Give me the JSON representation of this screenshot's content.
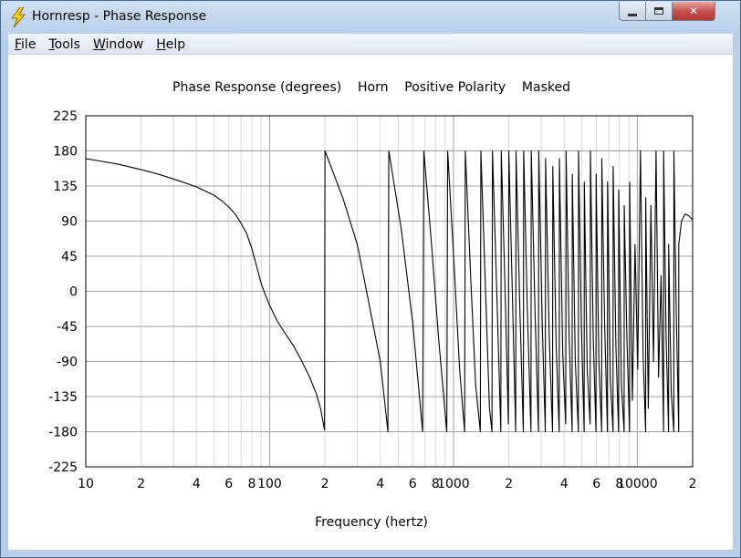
{
  "window": {
    "title": "Hornresp - Phase Response",
    "close_glyph": "✕"
  },
  "menu": {
    "items": [
      {
        "label": "File",
        "accel": "F",
        "rest": "ile"
      },
      {
        "label": "Tools",
        "accel": "T",
        "rest": "ools"
      },
      {
        "label": "Window",
        "accel": "W",
        "rest": "indow"
      },
      {
        "label": "Help",
        "accel": "H",
        "rest": "elp"
      }
    ]
  },
  "icons": {
    "app": "lightning-bolt-icon",
    "minimize": "minimize-icon",
    "maximize": "maximize-icon",
    "close": "close-icon"
  },
  "colors": {
    "trace": "#000000",
    "major_grid": "#a0a0a0",
    "minor_grid": "#d8d8d8",
    "close_button": "#c75050",
    "app_icon": "#f5d020"
  },
  "chart_data": {
    "type": "line",
    "title": "Phase Response (degrees)    Horn    Positive Polarity    Masked",
    "xlabel": "Frequency (hertz)",
    "ylabel": "",
    "xscale": "log",
    "xlim": [
      10,
      20000
    ],
    "ylim": [
      -225,
      225
    ],
    "yticks": [
      225,
      180,
      135,
      90,
      45,
      0,
      -45,
      -90,
      -135,
      -180,
      -225
    ],
    "xtick_labels": [
      {
        "value": 10,
        "label": "10"
      },
      {
        "value": 20,
        "label": "2"
      },
      {
        "value": 40,
        "label": "4"
      },
      {
        "value": 60,
        "label": "6"
      },
      {
        "value": 80,
        "label": "8"
      },
      {
        "value": 100,
        "label": "100"
      },
      {
        "value": 200,
        "label": "2"
      },
      {
        "value": 400,
        "label": "4"
      },
      {
        "value": 600,
        "label": "6"
      },
      {
        "value": 800,
        "label": "8"
      },
      {
        "value": 1000,
        "label": "1000"
      },
      {
        "value": 2000,
        "label": "2"
      },
      {
        "value": 4000,
        "label": "4"
      },
      {
        "value": 6000,
        "label": "6"
      },
      {
        "value": 8000,
        "label": "8"
      },
      {
        "value": 10000,
        "label": "10000"
      },
      {
        "value": 20000,
        "label": "2"
      }
    ],
    "grid": true,
    "series": [
      {
        "name": "",
        "wrap_range": [
          -180,
          180
        ],
        "points": [
          [
            10,
            170
          ],
          [
            12,
            167
          ],
          [
            15,
            163
          ],
          [
            20,
            156
          ],
          [
            25,
            150
          ],
          [
            30,
            144
          ],
          [
            40,
            134
          ],
          [
            50,
            123
          ],
          [
            55,
            116
          ],
          [
            60,
            108
          ],
          [
            65,
            99
          ],
          [
            70,
            87
          ],
          [
            75,
            74
          ],
          [
            80,
            55
          ],
          [
            85,
            32
          ],
          [
            90,
            10
          ],
          [
            95,
            -5
          ],
          [
            100,
            -18
          ],
          [
            110,
            -38
          ],
          [
            120,
            -52
          ],
          [
            135,
            -70
          ],
          [
            150,
            -90
          ],
          [
            165,
            -110
          ],
          [
            180,
            -132
          ],
          [
            190,
            -152
          ],
          [
            199,
            -178
          ],
          [
            200,
            180
          ],
          [
            250,
            120
          ],
          [
            300,
            60
          ],
          [
            350,
            -20
          ],
          [
            400,
            -90
          ],
          [
            440,
            -180
          ],
          [
            445,
            180
          ],
          [
            520,
            80
          ],
          [
            600,
            -40
          ],
          [
            680,
            -180
          ],
          [
            690,
            180
          ],
          [
            760,
            60
          ],
          [
            830,
            -60
          ],
          [
            920,
            -180
          ],
          [
            930,
            180
          ],
          [
            1010,
            30
          ],
          [
            1080,
            -100
          ],
          [
            1150,
            -180
          ],
          [
            1160,
            180
          ],
          [
            1240,
            20
          ],
          [
            1320,
            -120
          ],
          [
            1400,
            -180
          ],
          [
            1410,
            180
          ],
          [
            1490,
            10
          ],
          [
            1570,
            -150
          ],
          [
            1620,
            -180
          ],
          [
            1630,
            180
          ],
          [
            1720,
            0
          ],
          [
            1810,
            -180
          ],
          [
            1820,
            180
          ],
          [
            1900,
            20
          ],
          [
            1990,
            -170
          ],
          [
            2000,
            180
          ],
          [
            2090,
            0
          ],
          [
            2180,
            -180
          ],
          [
            2190,
            180
          ],
          [
            2290,
            -10
          ],
          [
            2400,
            -180
          ],
          [
            2410,
            180
          ],
          [
            2520,
            -20
          ],
          [
            2640,
            -180
          ],
          [
            2650,
            180
          ],
          [
            2780,
            -30
          ],
          [
            2900,
            -180
          ],
          [
            2910,
            180
          ],
          [
            3040,
            -40
          ],
          [
            3160,
            -180
          ],
          [
            3170,
            170
          ],
          [
            3320,
            -60
          ],
          [
            3460,
            -180
          ],
          [
            3470,
            160
          ],
          [
            3620,
            -70
          ],
          [
            3760,
            -180
          ],
          [
            3770,
            170
          ],
          [
            3930,
            -80
          ],
          [
            4080,
            -170
          ],
          [
            4100,
            180
          ],
          [
            4260,
            -60
          ],
          [
            4420,
            -180
          ],
          [
            4430,
            150
          ],
          [
            4600,
            -90
          ],
          [
            4780,
            -180
          ],
          [
            4790,
            180
          ],
          [
            4960,
            -40
          ],
          [
            5140,
            -180
          ],
          [
            5150,
            140
          ],
          [
            5340,
            -100
          ],
          [
            5540,
            -170
          ],
          [
            5560,
            180
          ],
          [
            5760,
            -60
          ],
          [
            5960,
            -180
          ],
          [
            5970,
            150
          ],
          [
            6180,
            -90
          ],
          [
            6400,
            -180
          ],
          [
            6410,
            170
          ],
          [
            6640,
            -40
          ],
          [
            6880,
            -180
          ],
          [
            6890,
            140
          ],
          [
            7130,
            -110
          ],
          [
            7380,
            -180
          ],
          [
            7390,
            160
          ],
          [
            7650,
            -70
          ],
          [
            7910,
            -180
          ],
          [
            7920,
            130
          ],
          [
            8200,
            -120
          ],
          [
            8480,
            -180
          ],
          [
            8490,
            110
          ],
          [
            8780,
            -60
          ],
          [
            9080,
            -180
          ],
          [
            9090,
            140
          ],
          [
            9400,
            -140
          ],
          [
            9720,
            60
          ],
          [
            10050,
            -100
          ],
          [
            10400,
            180
          ],
          [
            10750,
            -80
          ],
          [
            11100,
            -180
          ],
          [
            11110,
            120
          ],
          [
            11480,
            -150
          ],
          [
            11860,
            110
          ],
          [
            12250,
            -90
          ],
          [
            12650,
            180
          ],
          [
            13050,
            -110
          ],
          [
            13470,
            20
          ],
          [
            13900,
            -180
          ],
          [
            13910,
            180
          ],
          [
            14350,
            -60
          ],
          [
            14800,
            -180
          ],
          [
            14810,
            60
          ],
          [
            15300,
            -130
          ],
          [
            15800,
            -180
          ],
          [
            15810,
            180
          ],
          [
            16300,
            -30
          ],
          [
            16800,
            -180
          ],
          [
            16810,
            60
          ],
          [
            17400,
            90
          ],
          [
            18200,
            99
          ],
          [
            19000,
            97
          ],
          [
            20000,
            92
          ]
        ]
      }
    ]
  }
}
